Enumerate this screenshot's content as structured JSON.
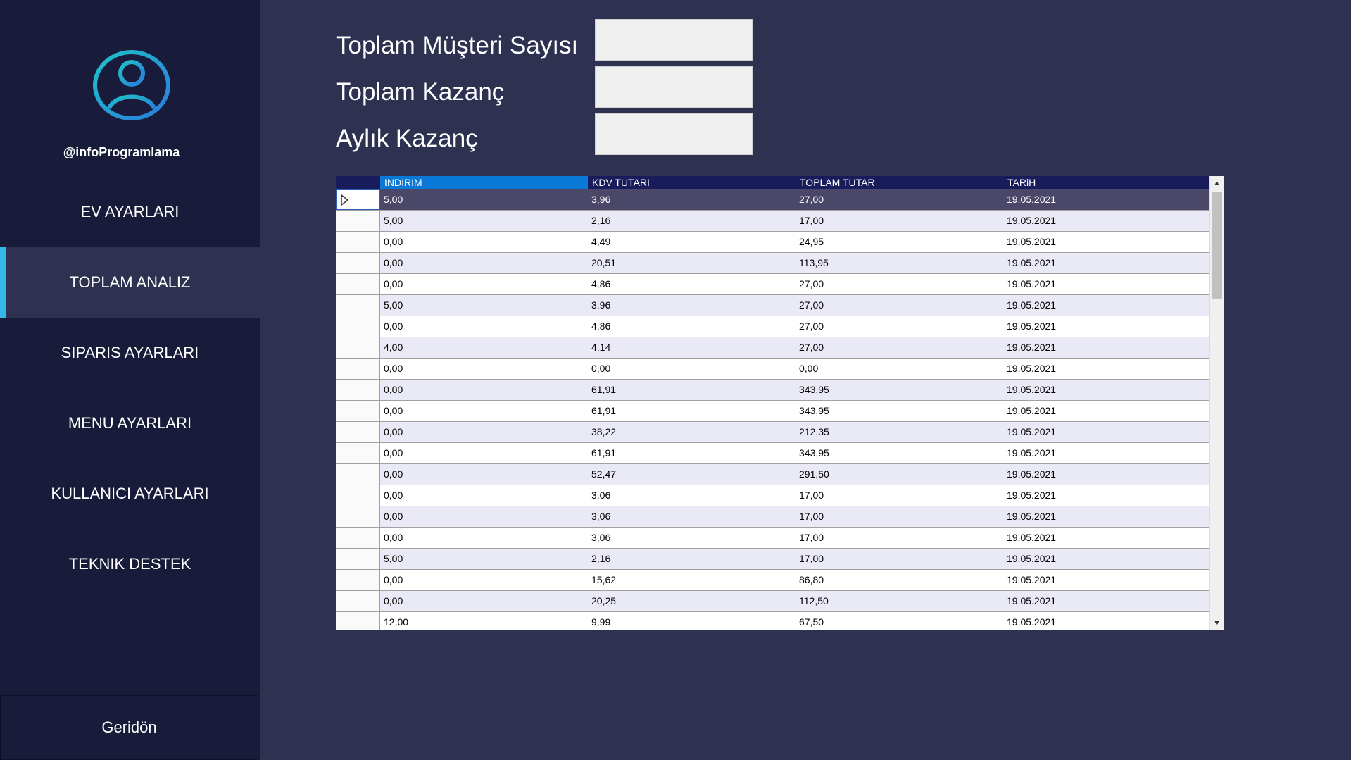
{
  "sidebar": {
    "username": "@infoProgramlama",
    "items": [
      {
        "label": "EV AYARLARI"
      },
      {
        "label": "TOPLAM ANALIZ"
      },
      {
        "label": "SIPARIS AYARLARI"
      },
      {
        "label": "MENU AYARLARI"
      },
      {
        "label": "KULLANICI AYARLARI"
      },
      {
        "label": "TEKNIK DESTEK"
      }
    ],
    "active_item": "TOPLAM ANALIZ",
    "back_label": "Geridön"
  },
  "stats": {
    "customer_count_label": "Toplam Müşteri Sayısı",
    "customer_count_value": "",
    "total_earnings_label": "Toplam Kazanç",
    "total_earnings_value": "",
    "monthly_earnings_label": "Aylık Kazanç",
    "monthly_earnings_value": ""
  },
  "grid": {
    "columns": [
      "INDIRIM",
      "KDV TUTARI",
      "TOPLAM TUTAR",
      "TARiH"
    ],
    "rows": [
      [
        "5,00",
        "3,96",
        "27,00",
        "19.05.2021"
      ],
      [
        "5,00",
        "2,16",
        "17,00",
        "19.05.2021"
      ],
      [
        "0,00",
        "4,49",
        "24,95",
        "19.05.2021"
      ],
      [
        "0,00",
        "20,51",
        "113,95",
        "19.05.2021"
      ],
      [
        "0,00",
        "4,86",
        "27,00",
        "19.05.2021"
      ],
      [
        "5,00",
        "3,96",
        "27,00",
        "19.05.2021"
      ],
      [
        "0,00",
        "4,86",
        "27,00",
        "19.05.2021"
      ],
      [
        "4,00",
        "4,14",
        "27,00",
        "19.05.2021"
      ],
      [
        "0,00",
        "0,00",
        "0,00",
        "19.05.2021"
      ],
      [
        "0,00",
        "61,91",
        "343,95",
        "19.05.2021"
      ],
      [
        "0,00",
        "61,91",
        "343,95",
        "19.05.2021"
      ],
      [
        "0,00",
        "38,22",
        "212,35",
        "19.05.2021"
      ],
      [
        "0,00",
        "61,91",
        "343,95",
        "19.05.2021"
      ],
      [
        "0,00",
        "52,47",
        "291,50",
        "19.05.2021"
      ],
      [
        "0,00",
        "3,06",
        "17,00",
        "19.05.2021"
      ],
      [
        "0,00",
        "3,06",
        "17,00",
        "19.05.2021"
      ],
      [
        "0,00",
        "3,06",
        "17,00",
        "19.05.2021"
      ],
      [
        "5,00",
        "2,16",
        "17,00",
        "19.05.2021"
      ],
      [
        "0,00",
        "15,62",
        "86,80",
        "19.05.2021"
      ],
      [
        "0,00",
        "20,25",
        "112,50",
        "19.05.2021"
      ],
      [
        "12,00",
        "9,99",
        "67,50",
        "19.05.2021"
      ]
    ],
    "selected_row": 0
  },
  "icons": {
    "avatar": "user-circle-icon",
    "row_pointer": "triangle-right-icon",
    "scroll_up": "chevron-up-icon",
    "scroll_down": "chevron-down-icon"
  },
  "colors": {
    "background": "#2e3250",
    "sidebar": "#181c3a",
    "accent": "#35b9e8",
    "header": "#181c5a",
    "header_selected": "#0a78d7"
  }
}
